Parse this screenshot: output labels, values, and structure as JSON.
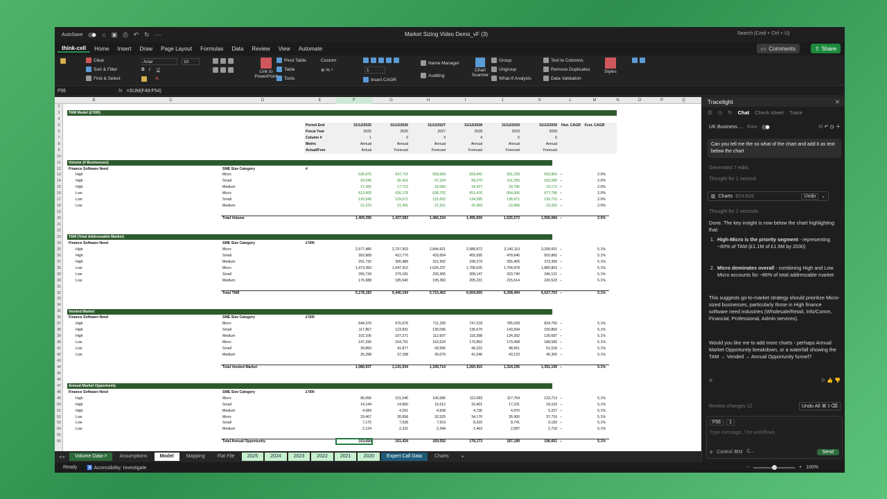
{
  "titlebar": {
    "autosave": "AutoSave",
    "doc_title": "Market Sizing Video Demo_vF (3)",
    "search": "Search (Cmd + Ctrl + U)"
  },
  "menu": [
    "think-cell",
    "Home",
    "Insert",
    "Draw",
    "Page Layout",
    "Formulas",
    "Data",
    "Review",
    "View",
    "Automate"
  ],
  "buttons": {
    "comments": "Comments",
    "share": "Share"
  },
  "ribbon": {
    "clear": "Clear",
    "sort": "Sort & Filter",
    "find": "Find & Select",
    "font": "Arial",
    "size": "10",
    "link": "Link to PowerPoint",
    "pivot": "Pivot Table",
    "table": "Table",
    "tools": "Tools",
    "numfmt": "Custom",
    "insert_cagr": "Insert CAGR",
    "name_manager": "Name Manager",
    "auditing": "Auditing",
    "chart_scanner": "Chart Scanner",
    "group": "Group",
    "ungroup": "Ungroup",
    "whatif": "What-If Analysis",
    "text_to_columns": "Text to Columns",
    "remove_dup": "Remove Duplicates",
    "data_validation": "Data Validation",
    "styles": "Styles",
    "one": "1"
  },
  "formula_bar": {
    "cell": "F56",
    "formula": "=SUM(F49:F54)",
    "fx": "fx"
  },
  "columns": [
    "B",
    "C",
    "D",
    "E",
    "F",
    "G",
    "H",
    "I",
    "J",
    "K",
    "L",
    "M",
    "N",
    "O",
    "P",
    "Q",
    "R",
    "S",
    "T"
  ],
  "rows": [
    "2",
    "3",
    "4",
    "5",
    "6",
    "7",
    "8",
    "9",
    "10",
    "11",
    "12",
    "13",
    "14",
    "15",
    "16",
    "17",
    "18",
    "19",
    "20",
    "21",
    "22",
    "23",
    "24",
    "25",
    "26",
    "27",
    "28",
    "29",
    "30",
    "31",
    "32",
    "33",
    "34",
    "35",
    "36",
    "37",
    "38",
    "39",
    "40",
    "41",
    "42",
    "43",
    "44",
    "45",
    "46",
    "47",
    "48",
    "49",
    "50",
    "51",
    "52",
    "53",
    "54",
    "55",
    "56"
  ],
  "sheet": {
    "title": "TAM Model (£'000)",
    "hdr_labels": [
      "Period End",
      "Fiscal Year",
      "Column #",
      "Metric",
      "Actual/Fore"
    ],
    "period_end": [
      "31/12/2025",
      "31/12/2026",
      "31/12/2027",
      "31/12/2028",
      "31/12/2029",
      "31/12/2030"
    ],
    "fiscal_year": [
      "2025",
      "2026",
      "2027",
      "2028",
      "2029",
      "2030"
    ],
    "column_num": [
      "1",
      "2",
      "3",
      "4",
      "5",
      "6"
    ],
    "metric": [
      "Annual",
      "Annual",
      "Annual",
      "Annual",
      "Annual",
      "Annual"
    ],
    "actual_fore": [
      "Actual",
      "Forecast",
      "Forecast",
      "Forecast",
      "Forecast",
      "Forecast"
    ],
    "hist_cagr": "Hist. CAGR",
    "fcst_cagr": "Fcst. CAGR",
    "col_fsn": "Finance Software Need",
    "col_sme": "SME Size Category",
    "sections": [
      {
        "title": "Volume (# Businesses)",
        "unit": "#",
        "total_label": "Total Volume",
        "total": [
          "1,409,395",
          "1,437,583",
          "1,466,334",
          "1,495,659",
          "1,525,573",
          "1,556,084"
        ],
        "total_cagr": "2.0%",
        "green": true,
        "rows": [
          [
            "High",
            "Micro",
            "536,975",
            "547,715",
            "558,669",
            "569,842",
            "581,239",
            "592,864",
            "2.0%"
          ],
          [
            "High",
            "Small",
            "93,545",
            "95,416",
            "97,324",
            "99,270",
            "101,255",
            "103,280",
            "2.0%"
          ],
          [
            "High",
            "Medium",
            "17,365",
            "17,712",
            "18,066",
            "18,427",
            "18,796",
            "19,172",
            "2.0%"
          ],
          [
            "Low",
            "Micro",
            "613,900",
            "626,178",
            "638,702",
            "651,476",
            "664,506",
            "677,796",
            "2.0%"
          ],
          [
            "Low",
            "Small",
            "126,540",
            "129,071",
            "131,652",
            "134,285",
            "136,971",
            "139,710",
            "2.0%"
          ],
          [
            "Low",
            "Medium",
            "21,070",
            "21,491",
            "21,921",
            "22,359",
            "22,806",
            "23,262",
            "2.0%"
          ]
        ]
      },
      {
        "title": "TAM (Total Addressable Market)",
        "unit": "£'000",
        "total_label": "Total TAM",
        "total": [
          "5,178,183",
          "5,440,194",
          "5,715,462",
          "6,004,650",
          "6,308,494",
          "6,627,703"
        ],
        "total_cagr": "5.1%",
        "green": false,
        "rows": [
          [
            "High",
            "Micro",
            "2,577,480",
            "2,707,903",
            "2,844,921",
            "2,988,872",
            "3,140,110",
            "3,299,001",
            "5.1%"
          ],
          [
            "High",
            "Small",
            "392,889",
            "412,770",
            "433,654",
            "455,595",
            "478,646",
            "502,865",
            "5.1%"
          ],
          [
            "High",
            "Medium",
            "291,732",
            "306,488",
            "321,992",
            "338,279",
            "355,405",
            "373,390",
            "5.1%"
          ],
          [
            "Low",
            "Micro",
            "1,473,360",
            "1,547,912",
            "1,626,237",
            "1,708,525",
            "1,794,978",
            "1,885,803",
            "5.1%"
          ],
          [
            "Low",
            "Small",
            "265,734",
            "279,181",
            "293,306",
            "308,147",
            "323,740",
            "340,121",
            "5.1%"
          ],
          [
            "Low",
            "Medium",
            "176,988",
            "185,940",
            "195,350",
            "205,231",
            "215,614",
            "226,523",
            "5.1%"
          ]
        ]
      },
      {
        "title": "Vended Market",
        "unit": "£'000",
        "total_label": "Total Vended Market",
        "total": [
          "1,086,937",
          "1,141,934",
          "1,199,714",
          "1,260,415",
          "1,324,195",
          "1,391,199"
        ],
        "total_cagr": "5.1%",
        "green": false,
        "rows": [
          [
            "High",
            "Micro",
            "644,370",
            "676,976",
            "711,230",
            "747,218",
            "785,028",
            "824,750",
            "5.1%"
          ],
          [
            "High",
            "Small",
            "117,867",
            "123,831",
            "130,096",
            "136,679",
            "143,594",
            "150,860",
            "5.1%"
          ],
          [
            "High",
            "Medium",
            "102,106",
            "107,271",
            "112,697",
            "118,398",
            "124,392",
            "130,687",
            "5.1%"
          ],
          [
            "Low",
            "Micro",
            "147,336",
            "154,791",
            "162,624",
            "170,852",
            "179,498",
            "188,580",
            "5.1%"
          ],
          [
            "Low",
            "Small",
            "39,860",
            "41,877",
            "43,996",
            "46,222",
            "48,561",
            "51,018",
            "5.1%"
          ],
          [
            "Low",
            "Medium",
            "35,398",
            "37,188",
            "39,070",
            "41,046",
            "43,123",
            "45,305",
            "5.1%"
          ]
        ]
      },
      {
        "title": "Annual Market Opportunity",
        "unit": "£'000",
        "total_label": "Total Annual Opportunity",
        "total": [
          "153,650",
          "161,424",
          "169,592",
          "178,173",
          "187,189",
          "196,661"
        ],
        "total_cagr": "5.1%",
        "green": false,
        "rows": [
          [
            "High",
            "Micro",
            "96,656",
            "101,546",
            "106,685",
            "112,083",
            "117,754",
            "123,713",
            "5.1%"
          ],
          [
            "High",
            "Small",
            "14,144",
            "14,860",
            "15,612",
            "16,401",
            "17,231",
            "18,103",
            "5.1%"
          ],
          [
            "High",
            "Medium",
            "4,084",
            "4,291",
            "4,508",
            "4,736",
            "4,976",
            "5,227",
            "5.1%"
          ],
          [
            "Low",
            "Micro",
            "29,467",
            "30,958",
            "32,525",
            "34,170",
            "35,900",
            "37,716",
            "5.1%"
          ],
          [
            "Low",
            "Small",
            "7,175",
            "7,538",
            "7,919",
            "8,320",
            "8,741",
            "9,183",
            "5.1%"
          ],
          [
            "Low",
            "Medium",
            "2,124",
            "2,231",
            "2,344",
            "2,463",
            "2,587",
            "2,718",
            "5.1%"
          ]
        ]
      }
    ]
  },
  "tabs": [
    {
      "label": "Volume Data->",
      "style": "dk"
    },
    {
      "label": "Assumptions",
      "style": ""
    },
    {
      "label": "Model",
      "style": "sel"
    },
    {
      "label": "Mapping",
      "style": ""
    },
    {
      "label": "Flat File",
      "style": ""
    },
    {
      "label": "2025",
      "style": "green"
    },
    {
      "label": "2024",
      "style": "green"
    },
    {
      "label": "2023",
      "style": "green"
    },
    {
      "label": "2022",
      "style": "green"
    },
    {
      "label": "2021",
      "style": "green"
    },
    {
      "label": "2020",
      "style": "green"
    },
    {
      "label": "Expert Call Data",
      "style": "bl"
    },
    {
      "label": "Charts",
      "style": ""
    }
  ],
  "status": {
    "ready": "Ready",
    "accessibility": "Accessibility: Investigate",
    "zoom": "100%"
  },
  "panel": {
    "title": "Tracelight",
    "tabs": [
      "Chat",
      "Check sheet",
      "Trace"
    ],
    "model": "UK Business ...",
    "raw": "Raw",
    "user_msg": "Can you tell me the so what of the chart and add it as text below the chart",
    "generated": "Generated 7 edits",
    "thought1": "Thought for 1 second",
    "charts_label": "Charts",
    "charts_range": "B24:B26",
    "undo": "Undo",
    "thought2": "Thought for 2 seconds",
    "intro": "Done. The key insight is now below the chart highlighting that:",
    "point1_bold": "High-Micro is the priority segment",
    "point1": " - representing ~60% of TAM (£1.1M of £1.9M by 2030)",
    "point2_bold": "Micro dominates overall",
    "point2": " - combining High and Low Micro accounts for ~86% of total addressable market",
    "para": "This suggests go-to-market strategy should prioritize Micro-sized businesses, particularly those in High finance software need industries (Wholesale/Retail, Info/Comm, Financial, Professional, Admin services).",
    "followup": "Would you like me to add more charts - perhaps Annual Market Opportunity breakdown, or a waterfall showing the TAM → Vended → Annual Opportunity funnel?",
    "review": "Review changes 12",
    "undo_all": "Undo All ⌘⇧⌫",
    "ctx_cell": "F56",
    "ctx_count": "1",
    "placeholder": "Type message, / for workflows",
    "control": "Control ⌘M",
    "mode": "C...",
    "send": "Send"
  }
}
